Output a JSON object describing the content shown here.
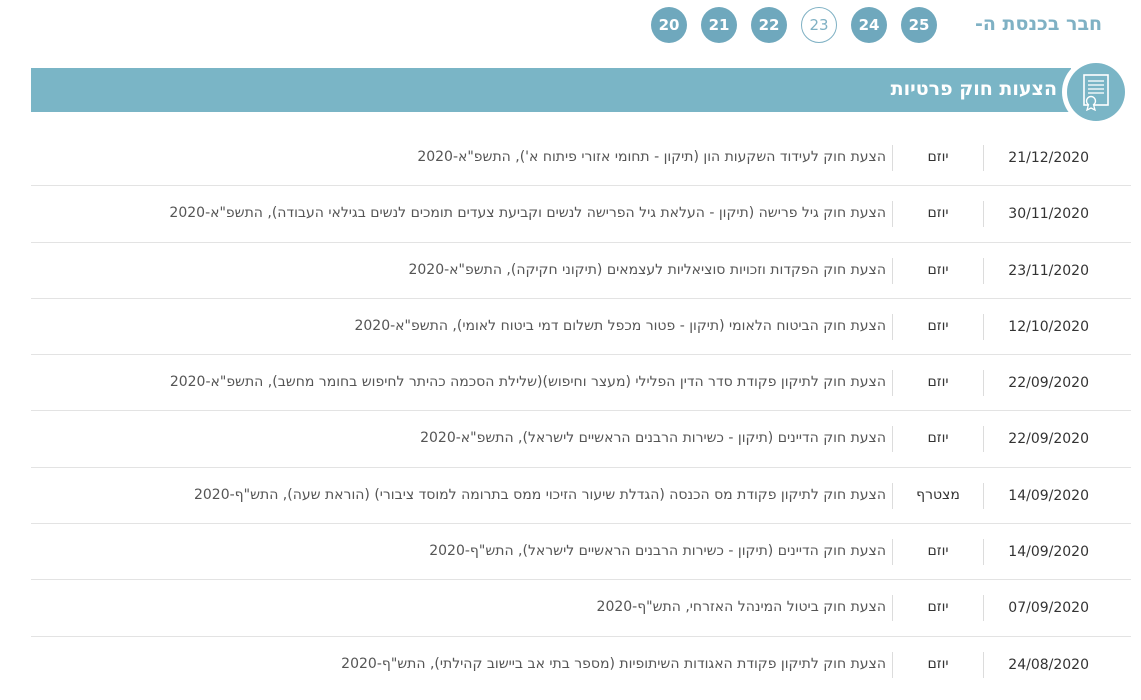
{
  "knesset": {
    "label": "חבר בכנסת ה-",
    "numbers": [
      {
        "value": "25",
        "active": false
      },
      {
        "value": "24",
        "active": false
      },
      {
        "value": "23",
        "active": true
      },
      {
        "value": "22",
        "active": false
      },
      {
        "value": "21",
        "active": false
      },
      {
        "value": "20",
        "active": false
      }
    ]
  },
  "section": {
    "title": "הצעות חוק פרטיות",
    "icon": "certificate-document-icon"
  },
  "colors": {
    "accent": "#7ab5c6",
    "circle": "#6fa8bd"
  },
  "bills": [
    {
      "date": "21/12/2020",
      "role": "יוזם",
      "title": "הצעת חוק לעידוד השקעות הון (תיקון - תחומי אזורי פיתוח א'), התשפ\"א-2020"
    },
    {
      "date": "30/11/2020",
      "role": "יוזם",
      "title": "הצעת חוק גיל פרישה (תיקון - העלאת גיל הפרישה לנשים וקביעת צעדים תומכים לנשים בגילאי העבודה), התשפ\"א-2020"
    },
    {
      "date": "23/11/2020",
      "role": "יוזם",
      "title": "הצעת חוק הפקדות וזכויות סוציאליות לעצמאים (תיקוני חקיקה), התשפ\"א-2020"
    },
    {
      "date": "12/10/2020",
      "role": "יוזם",
      "title": "הצעת חוק הביטוח הלאומי (תיקון - פטור מכפל תשלום דמי ביטוח לאומי), התשפ\"א-2020"
    },
    {
      "date": "22/09/2020",
      "role": "יוזם",
      "title": "הצעת חוק לתיקון פקודת סדר הדין הפלילי (מעצר וחיפוש)(שלילת הסכמה כהיתר לחיפוש בחומר מחשב), התשפ\"א-2020"
    },
    {
      "date": "22/09/2020",
      "role": "יוזם",
      "title": "הצעת חוק הדיינים (תיקון - כשירות הרבנים הראשיים לישראל), התשפ\"א-2020"
    },
    {
      "date": "14/09/2020",
      "role": "מצטרף",
      "title": "הצעת חוק לתיקון פקודת מס הכנסה (הגדלת שיעור הזיכוי ממס בתרומה למוסד ציבורי) (הוראת שעה), התש\"ף-2020"
    },
    {
      "date": "14/09/2020",
      "role": "יוזם",
      "title": "הצעת חוק הדיינים (תיקון - כשירות הרבנים הראשיים לישראל), התש\"ף-2020"
    },
    {
      "date": "07/09/2020",
      "role": "יוזם",
      "title": "הצעת חוק ביטול המינהל האזרחי, התש\"ף-2020"
    },
    {
      "date": "24/08/2020",
      "role": "יוזם",
      "title": "הצעת חוק לתיקון פקודת האגודות השיתופיות (מספר בתי אב ביישוב קהילתי), התש\"ף-2020"
    }
  ]
}
